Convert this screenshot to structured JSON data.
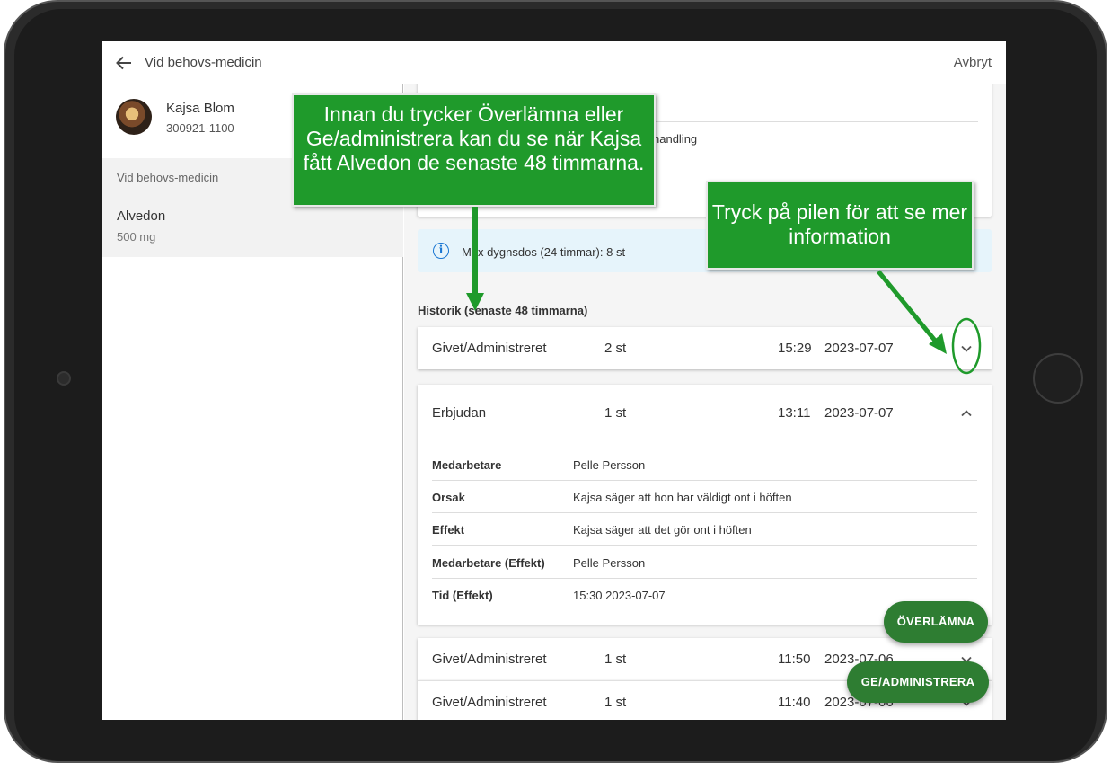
{
  "appbar": {
    "title": "Vid behovs-medicin",
    "cancel": "Avbryt"
  },
  "patient": {
    "name": "Kajsa Blom",
    "id": "300921-1100"
  },
  "sidebar": {
    "section_label": "Vid behovs-medicin",
    "items": [
      {
        "name": "Alvedon",
        "dose": "500 mg"
      }
    ]
  },
  "top_card": {
    "row1": "Max dygnsdos (24 timmar): 8",
    "row2": "handling"
  },
  "info": {
    "text": "Max dygnsdos (24 timmar): 8 st"
  },
  "history": {
    "title": "Historik (senaste 48 timmarna)",
    "rows": [
      {
        "label": "Givet/Administreret",
        "qty": "2 st",
        "time": "15:29",
        "date": "2023-07-07",
        "expanded": false
      },
      {
        "label": "Erbjudan",
        "qty": "1 st",
        "time": "13:11",
        "date": "2023-07-07",
        "expanded": true
      },
      {
        "label": "Givet/Administreret",
        "qty": "1 st",
        "time": "11:50",
        "date": "2023-07-06",
        "expanded": false
      },
      {
        "label": "Givet/Administreret",
        "qty": "1 st",
        "time": "11:40",
        "date": "2023-07-06",
        "expanded": false
      }
    ],
    "details": [
      {
        "key": "Medarbetare",
        "value": "Pelle Persson"
      },
      {
        "key": "Orsak",
        "value": "Kajsa säger att hon har väldigt ont i höften"
      },
      {
        "key": "Effekt",
        "value": "Kajsa säger att det gör ont i höften"
      },
      {
        "key": "Medarbetare (Effekt)",
        "value": "Pelle Persson"
      },
      {
        "key": "Tid (Effekt)",
        "value": "15:30   2023-07-07"
      }
    ]
  },
  "actions": {
    "handover": "ÖVERLÄMNA",
    "administer": "GE/ADMINISTRERA"
  },
  "callouts": {
    "left": "Innan du trycker Överlämna eller Ge/administrera kan du se när Kajsa fått Alvedon de senaste 48 timmarna.",
    "right": "Tryck på pilen för att se mer information"
  },
  "colors": {
    "accent": "#2e7d32",
    "callout": "#1f9a2b",
    "info_bg": "#e6f4fb",
    "info_icon": "#1976d2"
  }
}
